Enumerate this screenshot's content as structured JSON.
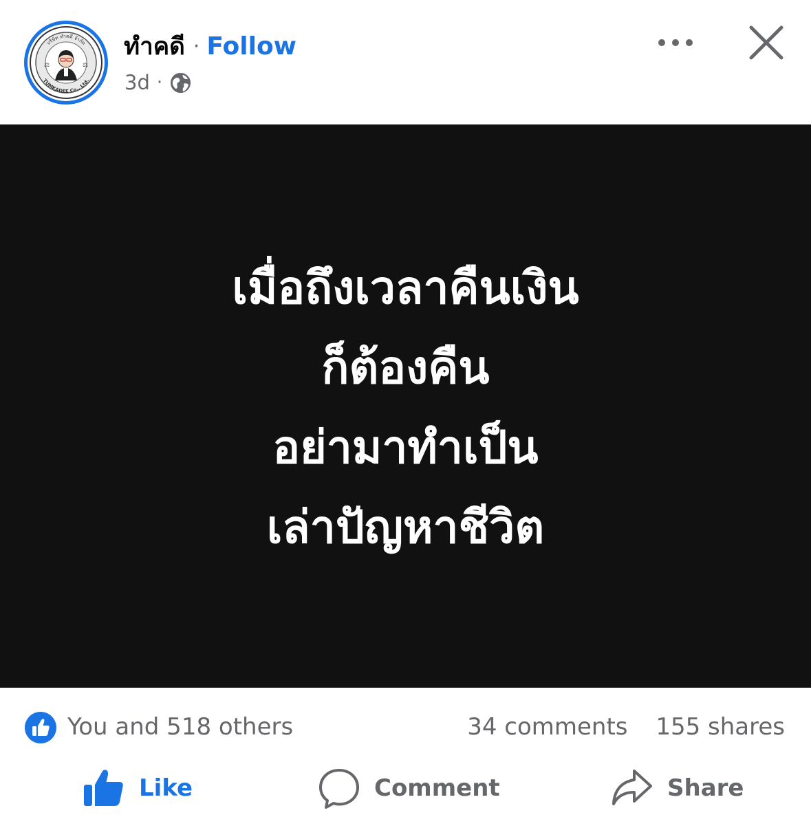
{
  "post": {
    "author": "ทำคดี",
    "name_separator": "·",
    "follow_label": "Follow",
    "time": "3d",
    "meta_separator": "·",
    "audience_icon": "globe-icon"
  },
  "avatar": {
    "logo_top_text": "บริษัท ทำคดี จำกัด",
    "logo_bottom_text": "TUMKADEE Co., Ltd."
  },
  "header_actions": {
    "more_icon": "more-horizontal-icon",
    "close_icon": "close-icon"
  },
  "image": {
    "background_color": "#111111",
    "lines": [
      "เมื่อถึงเวลาคืนเงิน",
      "ก็ต้องคืน",
      "อย่ามาทำเป็น",
      "เล่าปัญหาชีวิต"
    ]
  },
  "stats": {
    "reaction_icon": "like-reaction-icon",
    "reactions_text": "You and 518 others",
    "comments_text": "34 comments",
    "shares_text": "155 shares"
  },
  "actions": {
    "like_label": "Like",
    "comment_label": "Comment",
    "share_label": "Share"
  },
  "colors": {
    "accent": "#1b74e4",
    "secondary_text": "#65676b",
    "primary_text": "#050505"
  }
}
